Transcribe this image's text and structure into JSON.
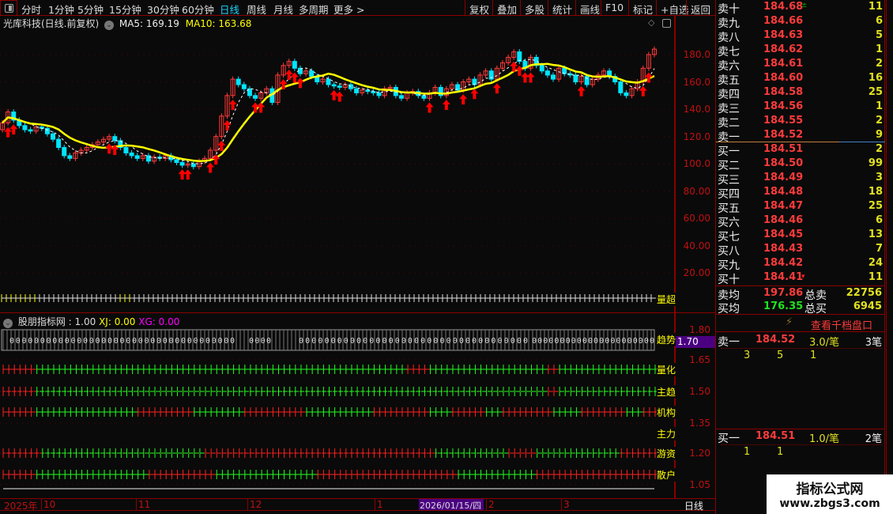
{
  "toolbar": {
    "periods": [
      "分时",
      "1分钟",
      "5分钟",
      "15分钟",
      "30分钟",
      "60分钟",
      "日线",
      "周线",
      "月线",
      "多周期",
      "更多 >"
    ],
    "active_period": "日线",
    "buttons": [
      "复权",
      "叠加",
      "多股",
      "统计",
      "画线",
      "F10",
      "标记",
      "+自选",
      "返回"
    ]
  },
  "main_chart": {
    "title": "光库科技(日线.前复权)",
    "ma5_label": "MA5: 169.19",
    "ma10_label": "MA10: 163.68",
    "y_ticks": [
      "180.0",
      "160.0",
      "140.0",
      "120.0",
      "100.0",
      "80.00",
      "60.00",
      "40.00",
      "20.00"
    ],
    "volume_row_label": "量超"
  },
  "chart_data": {
    "type": "candlestick",
    "y_ticks": [
      180,
      160,
      140,
      120,
      100,
      80,
      60,
      40,
      20
    ],
    "ylim": [
      10,
      200
    ],
    "close": [
      130,
      138,
      132,
      128,
      125,
      124,
      127,
      126,
      122,
      118,
      112,
      106,
      104,
      108,
      110,
      112,
      114,
      116,
      118,
      120,
      117,
      112,
      108,
      106,
      104,
      106,
      102,
      105,
      104,
      106,
      103,
      101,
      99,
      100,
      98,
      102,
      104,
      110,
      120,
      135,
      150,
      162,
      158,
      155,
      150,
      148,
      152,
      155,
      145,
      165,
      172,
      175,
      170,
      166,
      168,
      164,
      160,
      162,
      158,
      157,
      156,
      158,
      155,
      152,
      154,
      153,
      152,
      150,
      155,
      156,
      150,
      148,
      152,
      153,
      150,
      148,
      152,
      156,
      150,
      155,
      158,
      154,
      160,
      162,
      158,
      165,
      168,
      162,
      170,
      174,
      178,
      182,
      175,
      170,
      178,
      172,
      168,
      165,
      162,
      170,
      166,
      165,
      160,
      164,
      158,
      162,
      165,
      168,
      164,
      160,
      152,
      150,
      155,
      160,
      170,
      180,
      184
    ],
    "first_open": 125,
    "buy_signal_indices": [
      1,
      2,
      19,
      20,
      32,
      33,
      37,
      38,
      39,
      40,
      41,
      45,
      46,
      50,
      51,
      52,
      53,
      59,
      60,
      76,
      79,
      82,
      84,
      88,
      91,
      92,
      93,
      94,
      103,
      114,
      115
    ],
    "ma_periods": [
      5,
      10
    ],
    "colors": {
      "up": "#ff3b3b",
      "down": "#00e5ff",
      "ma5": "#ffffff",
      "ma10": "#ffff00",
      "signal": "#ff0000"
    }
  },
  "indicator": {
    "title": "股朋指标网",
    "value": ": 1.00",
    "xj": "XJ: 0.00",
    "xg": "XG: 0.00",
    "y_ticks": [
      "1.80",
      "1.65",
      "1.50",
      "1.35",
      "1.20",
      "1.05"
    ],
    "current_value": "1.70",
    "trend_label": "趋势",
    "trend_segments": [
      "0000000000000000000000000000000000000",
      "0000",
      "000000000000000000000000000000000000",
      "0000000000000000000000"
    ],
    "rows": [
      {
        "label": "量化",
        "runs": [
          [
            "R",
            6
          ],
          [
            "G",
            66
          ],
          [
            "R",
            4
          ],
          [
            "G",
            21
          ],
          [
            "R",
            2
          ],
          [
            "G",
            18
          ]
        ]
      },
      {
        "label": "主趋",
        "runs": [
          [
            "R",
            6
          ],
          [
            "G",
            91
          ],
          [
            "R",
            2
          ],
          [
            "G",
            18
          ]
        ]
      },
      {
        "label": "机构",
        "runs": [
          [
            "R",
            6
          ],
          [
            "G",
            18
          ],
          [
            "R",
            10
          ],
          [
            "G",
            9
          ],
          [
            "R",
            11
          ],
          [
            "G",
            12
          ],
          [
            "R",
            10
          ],
          [
            "G",
            4
          ],
          [
            "R",
            6
          ],
          [
            "G",
            3
          ],
          [
            "R",
            9
          ],
          [
            "G",
            5
          ],
          [
            "R",
            8
          ],
          [
            "G",
            3
          ],
          [
            "R",
            3
          ]
        ]
      },
      {
        "label": "主力",
        "runs": []
      },
      {
        "label": "游资",
        "runs": [
          [
            "R",
            7
          ],
          [
            "G",
            29
          ],
          [
            "R",
            41
          ],
          [
            "G",
            13
          ],
          [
            "R",
            5
          ],
          [
            "G",
            15
          ],
          [
            "R",
            7
          ]
        ]
      },
      {
        "label": "散户",
        "runs": [
          [
            "R",
            6
          ],
          [
            "G",
            20
          ],
          [
            "R",
            12
          ],
          [
            "G",
            18
          ],
          [
            "R",
            25
          ],
          [
            "G",
            14
          ],
          [
            "R",
            22
          ]
        ]
      }
    ]
  },
  "time_axis": {
    "labels": [
      "2025年",
      "10",
      "11",
      "12",
      "1",
      "2",
      "3"
    ],
    "cursor_date": "2026/01/15/四",
    "period_label": "日线"
  },
  "order_book": {
    "asks": [
      {
        "label": "卖十",
        "price": "184.68",
        "vol": "11"
      },
      {
        "label": "卖九",
        "price": "184.66",
        "vol": "6"
      },
      {
        "label": "卖八",
        "price": "184.63",
        "vol": "5"
      },
      {
        "label": "卖七",
        "price": "184.62",
        "vol": "1"
      },
      {
        "label": "卖六",
        "price": "184.61",
        "vol": "2"
      },
      {
        "label": "卖五",
        "price": "184.60",
        "vol": "16"
      },
      {
        "label": "卖四",
        "price": "184.58",
        "vol": "25"
      },
      {
        "label": "卖三",
        "price": "184.56",
        "vol": "1"
      },
      {
        "label": "卖二",
        "price": "184.55",
        "vol": "2"
      },
      {
        "label": "卖一",
        "price": "184.52",
        "vol": "9"
      }
    ],
    "bids": [
      {
        "label": "买一",
        "price": "184.51",
        "vol": "2"
      },
      {
        "label": "买二",
        "price": "184.50",
        "vol": "99"
      },
      {
        "label": "买三",
        "price": "184.49",
        "vol": "3"
      },
      {
        "label": "买四",
        "price": "184.48",
        "vol": "18"
      },
      {
        "label": "买五",
        "price": "184.47",
        "vol": "25"
      },
      {
        "label": "买六",
        "price": "184.46",
        "vol": "6"
      },
      {
        "label": "买七",
        "price": "184.45",
        "vol": "13"
      },
      {
        "label": "买八",
        "price": "184.43",
        "vol": "7"
      },
      {
        "label": "买九",
        "price": "184.42",
        "vol": "24"
      },
      {
        "label": "买十",
        "price": "184.41",
        "vol": "11"
      }
    ],
    "summary": {
      "ask_avg_label": "卖均",
      "ask_avg": "197.86",
      "total_ask_label": "总卖",
      "total_ask": "22756",
      "bid_avg_label": "买均",
      "bid_avg": "176.35",
      "total_bid_label": "总买",
      "total_bid": "6945"
    },
    "thousand_depth_link": "查看千档盘口",
    "ask1_detail": {
      "label": "卖一",
      "price": "184.52",
      "per_order": "3.0/笔",
      "orders": "3笔",
      "queue": [
        "3",
        "5",
        "1"
      ]
    },
    "bid1_detail": {
      "label": "买一",
      "price": "184.51",
      "per_order": "1.0/笔",
      "orders": "2笔",
      "queue": [
        "1",
        "1"
      ]
    }
  },
  "watermark": {
    "title": "指标公式网",
    "url": "www.zbgs3.com"
  }
}
